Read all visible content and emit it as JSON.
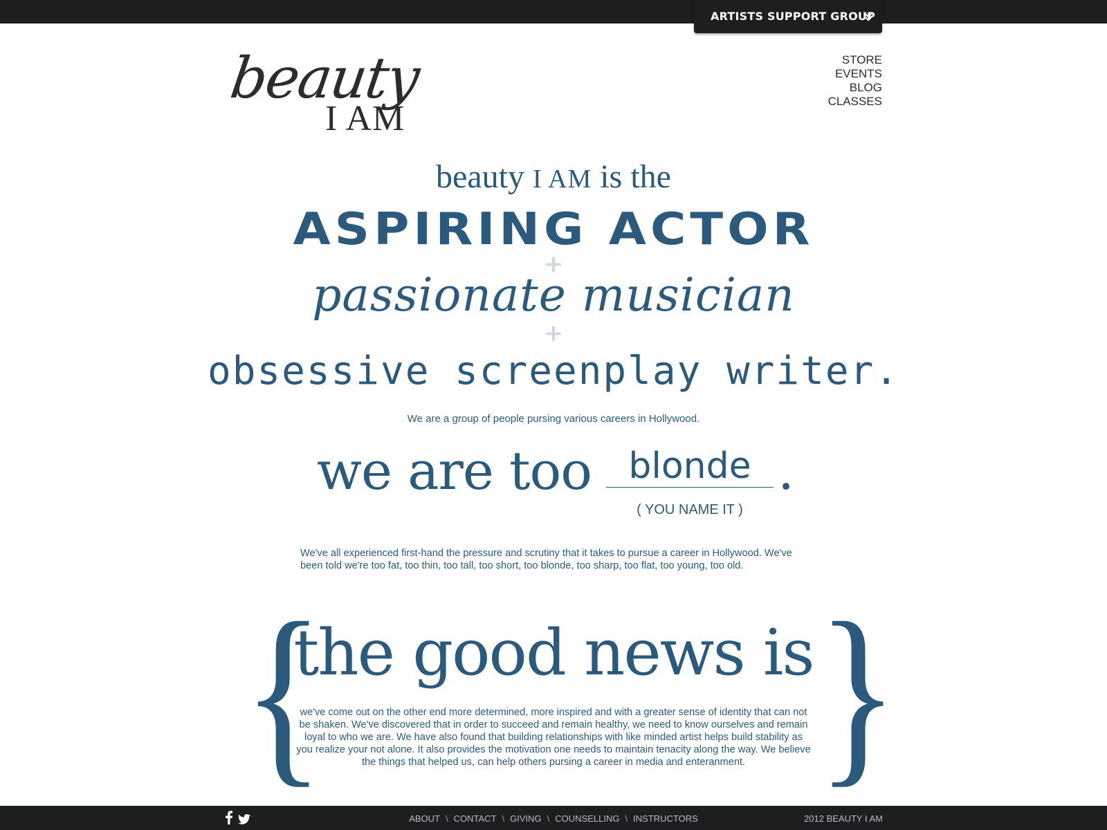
{
  "header": {
    "group_tab_label": "ARTISTS SUPPORT GROUP",
    "logo_script": "beauty",
    "logo_caps": "I AM"
  },
  "nav": {
    "items": [
      "STORE",
      "EVENTS",
      "BLOG",
      "CLASSES"
    ]
  },
  "hero": {
    "intro_prefix": "beauty",
    "intro_caps": "I AM",
    "intro_suffix": "is the",
    "role_1": "ASPIRING ACTOR",
    "plus": "+",
    "role_2": "passionate musician",
    "role_3": "obsessive screenplay writer.",
    "tagline": "We are a group of people pursing various careers in Hollywood."
  },
  "too": {
    "lead": "we are too",
    "blank_value": "blonde",
    "period": ".",
    "hint": "( YOU NAME IT )"
  },
  "para1": "We've all experienced first-hand the pressure and scrutiny that it takes to pursue a career in Hollywood.  We've been told we're too fat, too thin, too tall, too short, too blonde, too sharp, too flat, too young, too old.",
  "good_news": {
    "open_brace": "{",
    "close_brace": "}",
    "heading": "the good news is",
    "body": "we've come out on the other end more determined, more inspired and with a greater sense of identity that can not be shaken.  We've discovered that in order to succeed and remain healthy, we need to know ourselves and remain loyal to who we are.  We have also found that building relationships with like minded artist helps build stability as you realize your not alone. It also provides the motivation one needs to maintain tenacity along the way. We believe the things that helped us, can help others pursing a career in media and enteranment."
  },
  "footer": {
    "social": [
      "facebook-icon",
      "twitter-icon"
    ],
    "links": [
      "ABOUT",
      "CONTACT",
      "GIVING",
      "COUNSELLING",
      "INSTRUCTORS"
    ],
    "separator": "\\",
    "copyright": "2012 BEAUTY I AM"
  },
  "colors": {
    "brand_blue": "#2b5a7c",
    "bar_dark": "#1c1e1f",
    "plus_gray": "#ced8e0"
  }
}
